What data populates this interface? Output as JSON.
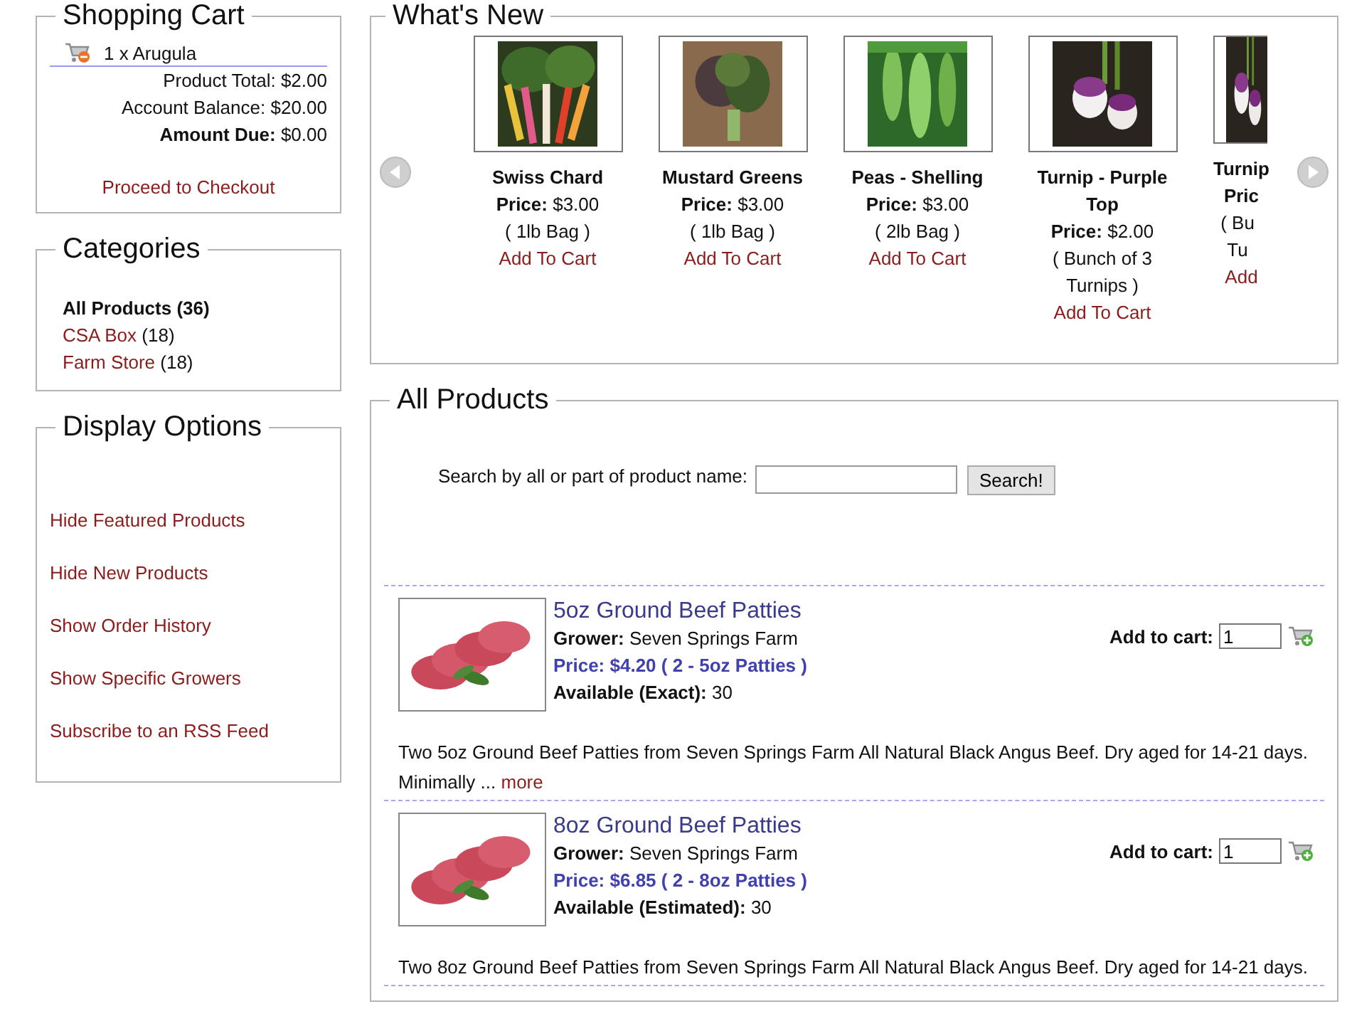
{
  "cart": {
    "title": "Shopping Cart",
    "items": [
      "1 x Arugula"
    ],
    "lines": [
      {
        "label": "Product Total:",
        "value": "$2.00",
        "bold": false
      },
      {
        "label": "Account Balance:",
        "value": "$20.00",
        "bold": false
      },
      {
        "label": "Amount Due:",
        "value": "$0.00",
        "bold": true
      }
    ],
    "checkout": "Proceed to Checkout"
  },
  "categories": {
    "title": "Categories",
    "items": [
      {
        "name": "All Products",
        "count": "(36)",
        "selected": true
      },
      {
        "name": "CSA Box",
        "count": "(18)",
        "selected": false
      },
      {
        "name": "Farm Store",
        "count": "(18)",
        "selected": false
      }
    ]
  },
  "display_options": {
    "title": "Display Options",
    "links": [
      "Hide Featured Products",
      "Hide New Products",
      "Show Order History",
      "Show Specific Growers",
      "Subscribe to an RSS Feed"
    ]
  },
  "whats_new": {
    "title": "What's New",
    "items": [
      {
        "name": "Swiss Chard",
        "price_label": "Price:",
        "price": "$3.00",
        "unit": "( 1lb Bag )",
        "add": "Add To Cart"
      },
      {
        "name": "Mustard Greens",
        "price_label": "Price:",
        "price": "$3.00",
        "unit": "( 1lb Bag )",
        "add": "Add To Cart"
      },
      {
        "name": "Peas - Shelling",
        "price_label": "Price:",
        "price": "$3.00",
        "unit": "( 2lb Bag )",
        "add": "Add To Cart"
      },
      {
        "name": "Turnip - Purple Top",
        "price_label": "Price:",
        "price": "$2.00",
        "unit": "( Bunch of 3 Turnips )",
        "add": "Add To Cart"
      },
      {
        "name": "Turnip",
        "price_label": "Pric",
        "unit": "( Bu Tu",
        "add": "Add",
        "partial": true
      }
    ]
  },
  "all_products": {
    "title": "All Products",
    "search_label": "Search by all or part of product name:",
    "search_button": "Search!",
    "products": [
      {
        "name": "5oz Ground Beef Patties",
        "grower_label": "Grower:",
        "grower": "Seven Springs Farm",
        "price": "Price: $4.20 ( 2 - 5oz Patties )",
        "avail_label": "Available (Exact):",
        "avail": "30",
        "add_label": "Add to cart:",
        "qty": "1",
        "description": "Two 5oz Ground Beef Patties from Seven Springs Farm All Natural Black Angus Beef. Dry aged for 14-21 days. Minimally ...",
        "more": "more"
      },
      {
        "name": "8oz Ground Beef Patties",
        "grower_label": "Grower:",
        "grower": "Seven Springs Farm",
        "price": "Price: $6.85 ( 2 - 8oz Patties )",
        "avail_label": "Available (Estimated):",
        "avail": "30",
        "add_label": "Add to cart:",
        "qty": "1",
        "description": "Two 8oz Ground Beef Patties from Seven Springs Farm All Natural Black Angus Beef. Dry aged for 14-21 days."
      }
    ]
  }
}
